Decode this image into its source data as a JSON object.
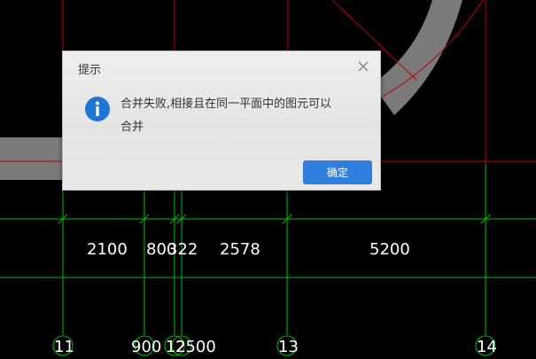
{
  "drawing": {
    "dimensions": [
      "2100",
      "800",
      "322",
      "2578",
      "5200"
    ],
    "axes": [
      "11",
      "900",
      "12",
      "2500",
      "13",
      "14"
    ],
    "colors": {
      "background": "#000000",
      "grid_green": "#00c000",
      "line_red": "#c00000",
      "wall_gray": "#7a7a7a"
    }
  },
  "dialog": {
    "title": "提示",
    "close_icon": "close-icon",
    "info_icon": "info-icon",
    "message_line1": "合并失败,相接且在同一平面中的图元可以",
    "message_line2": "合并",
    "ok_label": "确定",
    "accent": "#2f7fdf"
  }
}
